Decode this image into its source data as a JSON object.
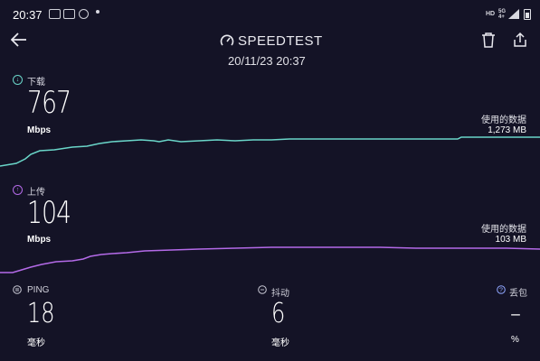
{
  "status_bar": {
    "time": "20:37",
    "network_hd": "HD",
    "network_5g": "5G",
    "network_5g_sub": "4+"
  },
  "header": {
    "title": "SPEEDTEST",
    "datetime": "20/11/23 20:37"
  },
  "download": {
    "label": "下载",
    "value": "767",
    "unit": "Mbps",
    "data_used_label": "使用的数据",
    "data_used_value": "1,273 MB",
    "color": "#6ad6c9"
  },
  "upload": {
    "label": "上传",
    "value": "104",
    "unit": "Mbps",
    "data_used_label": "使用的数据",
    "data_used_value": "103 MB",
    "color": "#b46ae8"
  },
  "stats": {
    "ping": {
      "label": "PING",
      "value": "18",
      "unit": "毫秒"
    },
    "jitter": {
      "label": "抖动",
      "value": "6",
      "unit": "毫秒"
    },
    "packet_loss": {
      "label": "丢包",
      "value": "–",
      "unit": "%"
    }
  },
  "icons": [
    "back-arrow-icon",
    "gauge-icon",
    "trash-icon",
    "share-icon",
    "download-icon",
    "upload-icon",
    "ping-icon",
    "jitter-icon",
    "packet-loss-icon"
  ]
}
